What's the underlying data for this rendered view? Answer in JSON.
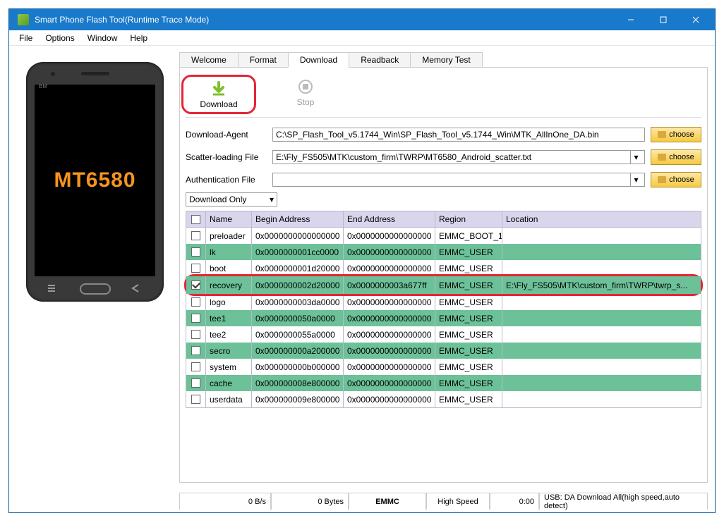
{
  "window": {
    "title": "Smart Phone Flash Tool(Runtime Trace Mode)"
  },
  "menu": {
    "file": "File",
    "options": "Options",
    "window": "Window",
    "help": "Help"
  },
  "phone": {
    "chip": "MT6580",
    "brand": "BM"
  },
  "tabs": {
    "welcome": "Welcome",
    "format": "Format",
    "download": "Download",
    "readback": "Readback",
    "memtest": "Memory Test"
  },
  "toolbar": {
    "download": "Download",
    "stop": "Stop"
  },
  "form": {
    "da_label": "Download-Agent",
    "da_value": "C:\\SP_Flash_Tool_v5.1744_Win\\SP_Flash_Tool_v5.1744_Win\\MTK_AllInOne_DA.bin",
    "scatter_label": "Scatter-loading File",
    "scatter_value": "E:\\Fly_FS505\\MTK\\custom_firm\\TWRP\\MT6580_Android_scatter.txt",
    "auth_label": "Authentication File",
    "auth_value": "",
    "choose": "choose",
    "mode": "Download Only"
  },
  "grid": {
    "headers": {
      "name": "Name",
      "begin": "Begin Address",
      "end": "End Address",
      "region": "Region",
      "location": "Location"
    },
    "rows": [
      {
        "chk": false,
        "name": "preloader",
        "begin": "0x0000000000000000",
        "end": "0x0000000000000000",
        "region": "EMMC_BOOT_1",
        "loc": ""
      },
      {
        "chk": false,
        "name": "lk",
        "begin": "0x0000000001cc0000",
        "end": "0x0000000000000000",
        "region": "EMMC_USER",
        "loc": ""
      },
      {
        "chk": false,
        "name": "boot",
        "begin": "0x0000000001d20000",
        "end": "0x0000000000000000",
        "region": "EMMC_USER",
        "loc": ""
      },
      {
        "chk": true,
        "name": "recovery",
        "begin": "0x0000000002d20000",
        "end": "0x0000000003a677ff",
        "region": "EMMC_USER",
        "loc": "E:\\Fly_FS505\\MTK\\custom_firm\\TWRP\\twrp_s..."
      },
      {
        "chk": false,
        "name": "logo",
        "begin": "0x0000000003da0000",
        "end": "0x0000000000000000",
        "region": "EMMC_USER",
        "loc": ""
      },
      {
        "chk": false,
        "name": "tee1",
        "begin": "0x0000000050a0000",
        "end": "0x0000000000000000",
        "region": "EMMC_USER",
        "loc": ""
      },
      {
        "chk": false,
        "name": "tee2",
        "begin": "0x0000000055a0000",
        "end": "0x0000000000000000",
        "region": "EMMC_USER",
        "loc": ""
      },
      {
        "chk": false,
        "name": "secro",
        "begin": "0x000000000a200000",
        "end": "0x0000000000000000",
        "region": "EMMC_USER",
        "loc": ""
      },
      {
        "chk": false,
        "name": "system",
        "begin": "0x000000000b000000",
        "end": "0x0000000000000000",
        "region": "EMMC_USER",
        "loc": ""
      },
      {
        "chk": false,
        "name": "cache",
        "begin": "0x000000008e800000",
        "end": "0x0000000000000000",
        "region": "EMMC_USER",
        "loc": ""
      },
      {
        "chk": false,
        "name": "userdata",
        "begin": "0x000000009e800000",
        "end": "0x0000000000000000",
        "region": "EMMC_USER",
        "loc": ""
      }
    ]
  },
  "status": {
    "speed": "0 B/s",
    "bytes": "0 Bytes",
    "storage": "EMMC",
    "usb": "High Speed",
    "time": "0:00",
    "mode": "USB: DA Download All(high speed,auto detect)"
  }
}
